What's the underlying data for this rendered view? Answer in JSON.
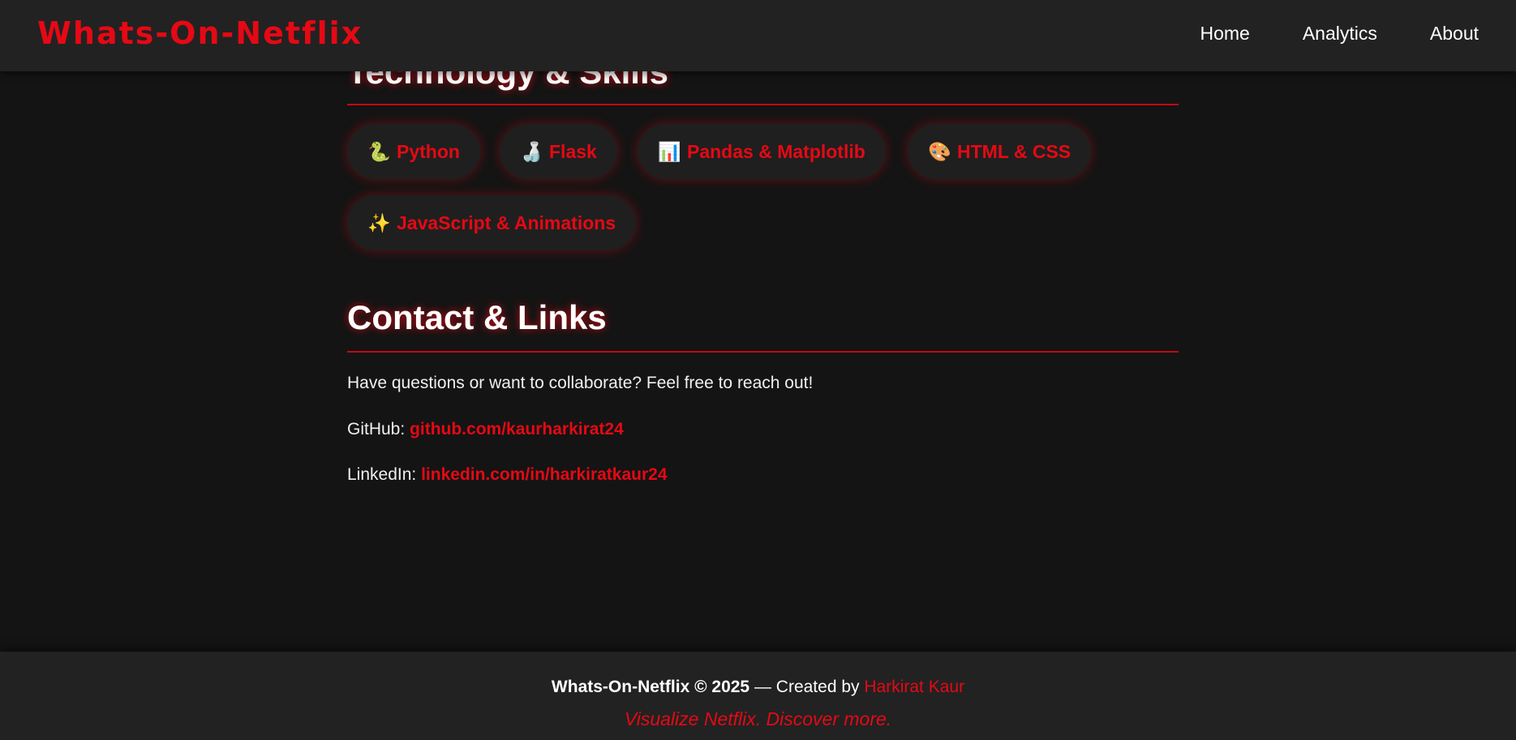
{
  "navbar": {
    "brand": "Whats-On-Netflix",
    "links": [
      {
        "label": "Home"
      },
      {
        "label": "Analytics"
      },
      {
        "label": "About"
      }
    ]
  },
  "tech_section": {
    "title": "Technology & Skills",
    "skills": [
      {
        "icon": "🐍",
        "icon_name": "python-icon",
        "label": "Python"
      },
      {
        "icon": "🍶",
        "icon_name": "flask-icon",
        "label": "Flask"
      },
      {
        "icon": "📊",
        "icon_name": "bar-chart-icon",
        "label": "Pandas & Matplotlib"
      },
      {
        "icon": "🎨",
        "icon_name": "palette-icon",
        "label": "HTML & CSS"
      },
      {
        "icon": "✨",
        "icon_name": "sparkles-icon",
        "label": "JavaScript & Animations"
      }
    ]
  },
  "contact_section": {
    "title": "Contact & Links",
    "intro": "Have questions or want to collaborate? Feel free to reach out!",
    "github_label": "GitHub:",
    "github_link": "github.com/kaurharkirat24",
    "linkedin_label": "LinkedIn:",
    "linkedin_link": "linkedin.com/in/harkiratkaur24"
  },
  "footer": {
    "brand": "Whats-On-Netflix © 2025",
    "created_by": "— Created by",
    "author": "Harkirat Kaur",
    "tagline": "Visualize Netflix. Discover more."
  },
  "colors": {
    "accent": "#e50914",
    "background": "#141414",
    "navbar": "#222222"
  }
}
